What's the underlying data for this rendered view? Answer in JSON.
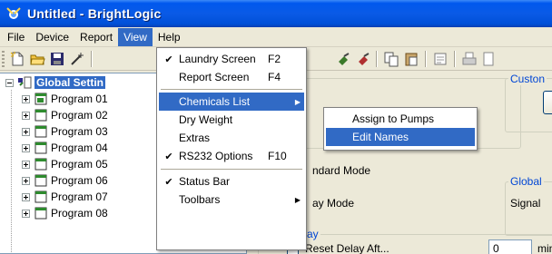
{
  "window": {
    "title": "Untitled - BrightLogic",
    "icon": "brightlogic-app-icon"
  },
  "menubar": {
    "items": [
      {
        "label": "File"
      },
      {
        "label": "Device"
      },
      {
        "label": "Report"
      },
      {
        "label": "View",
        "active": true
      },
      {
        "label": "Help"
      }
    ]
  },
  "toolbar": {
    "buttons": [
      "new-icon",
      "open-icon",
      "save-icon",
      "wand-icon",
      "sep",
      "tool-icon",
      "tool2-icon",
      "sep",
      "copy-icon",
      "paste-icon",
      "sep",
      "edit-icon",
      "sep",
      "print-icon"
    ]
  },
  "view_menu": {
    "items": [
      {
        "label": "Laundry Screen",
        "shortcut": "F2",
        "checked": true
      },
      {
        "label": "Report Screen",
        "shortcut": "F4",
        "checked": false
      },
      {
        "separator": true
      },
      {
        "label": "Chemicals List",
        "submenu": true,
        "highlighted": true
      },
      {
        "label": "Dry Weight"
      },
      {
        "label": "Extras"
      },
      {
        "label": "RS232 Options",
        "shortcut": "F10",
        "checked": true
      },
      {
        "separator": true
      },
      {
        "label": "Status Bar",
        "checked": true
      },
      {
        "label": "Toolbars",
        "submenu": true
      }
    ]
  },
  "chemicals_submenu": {
    "items": [
      {
        "label": "Assign to Pumps"
      },
      {
        "label": "Edit Names",
        "highlighted": true
      }
    ]
  },
  "tree": {
    "root": "Global Settin",
    "items": [
      "Program 01",
      "Program 02",
      "Program 03",
      "Program 04",
      "Program 05",
      "Program 06",
      "Program 07",
      "Program 08"
    ]
  },
  "right_panel": {
    "custom_group": "Custon",
    "standard_mode": "ndard Mode",
    "global_group": "Global",
    "display_mode": "ay Mode",
    "signal": "Signal",
    "delay_group": "ay",
    "reset_delay": "Reset Delay Aft...",
    "value": "0",
    "unit": "mins"
  },
  "colors": {
    "highlight": "#316ac5",
    "titlebar": "#0058ee",
    "group_title": "#0046d5"
  }
}
